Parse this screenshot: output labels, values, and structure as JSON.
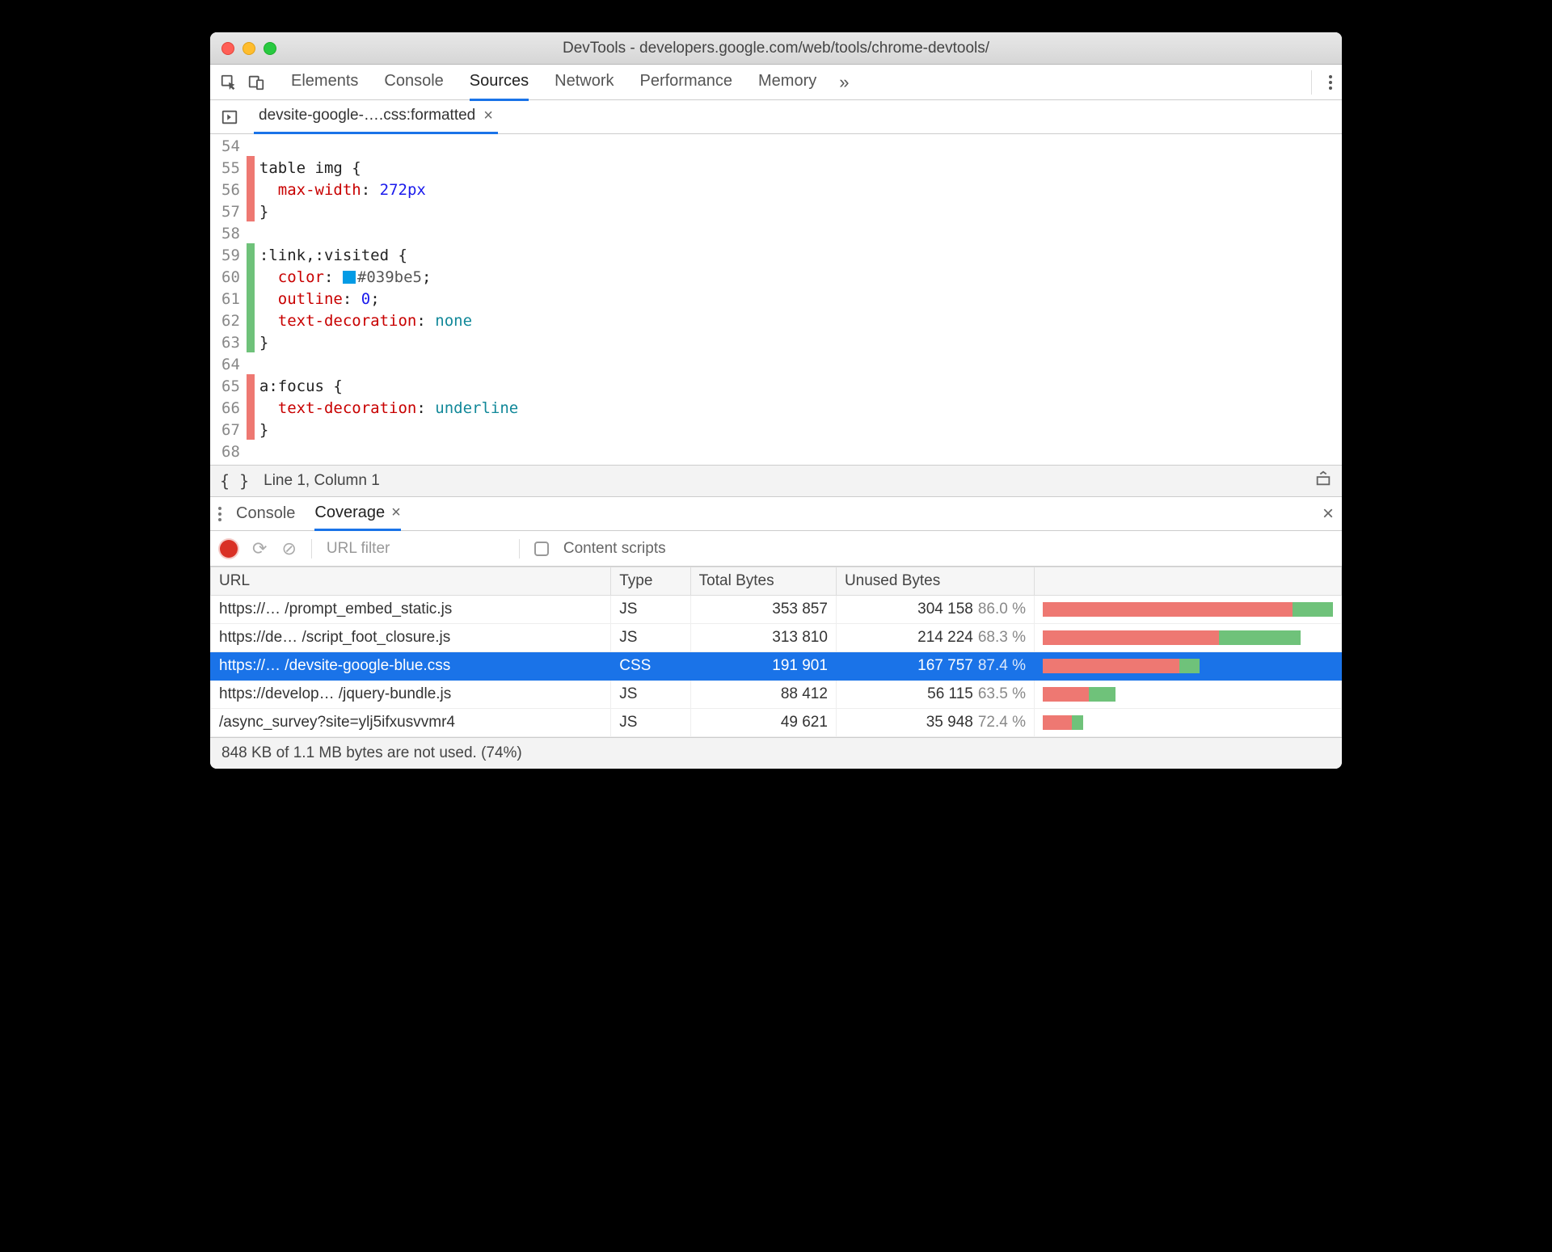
{
  "window": {
    "title": "DevTools - developers.google.com/web/tools/chrome-devtools/"
  },
  "mainTabs": [
    "Elements",
    "Console",
    "Sources",
    "Network",
    "Performance",
    "Memory"
  ],
  "mainTabActive": "Sources",
  "fileTab": {
    "name": "devsite-google-….css:formatted"
  },
  "code": {
    "startLine": 54,
    "lines": [
      {
        "n": 54,
        "cov": "",
        "html": ""
      },
      {
        "n": 55,
        "cov": "red",
        "html": "<span class='tok-sel'>table img</span> <span class='tok-brace'>{</span>"
      },
      {
        "n": 56,
        "cov": "red",
        "html": "  <span class='tok-prop'>max-width</span>: <span class='tok-val'>272px</span>"
      },
      {
        "n": 57,
        "cov": "red",
        "html": "<span class='tok-brace'>}</span>"
      },
      {
        "n": 58,
        "cov": "",
        "html": ""
      },
      {
        "n": 59,
        "cov": "green",
        "html": "<span class='tok-sel'>:link,:visited</span> <span class='tok-brace'>{</span>"
      },
      {
        "n": 60,
        "cov": "green",
        "html": "  <span class='tok-prop'>color</span>: <span class='swatch' style='background:#039be5'></span><span class='tok-color'>#039be5</span>;"
      },
      {
        "n": 61,
        "cov": "green",
        "html": "  <span class='tok-prop'>outline</span>: <span class='tok-val'>0</span>;"
      },
      {
        "n": 62,
        "cov": "green",
        "html": "  <span class='tok-prop'>text-decoration</span>: <span class='tok-kw'>none</span>"
      },
      {
        "n": 63,
        "cov": "green",
        "html": "<span class='tok-brace'>}</span>"
      },
      {
        "n": 64,
        "cov": "",
        "html": ""
      },
      {
        "n": 65,
        "cov": "red",
        "html": "<span class='tok-sel'>a:focus</span> <span class='tok-brace'>{</span>"
      },
      {
        "n": 66,
        "cov": "red",
        "html": "  <span class='tok-prop'>text-decoration</span>: <span class='tok-kw'>underline</span>"
      },
      {
        "n": 67,
        "cov": "red",
        "html": "<span class='tok-brace'>}</span>"
      },
      {
        "n": 68,
        "cov": "",
        "html": ""
      }
    ]
  },
  "status": {
    "cursor": "Line 1, Column 1"
  },
  "drawerTabs": [
    "Console",
    "Coverage"
  ],
  "drawerActive": "Coverage",
  "coverageToolbar": {
    "urlFilterPlaceholder": "URL filter",
    "contentScriptsLabel": "Content scripts"
  },
  "coverageHeaders": [
    "URL",
    "Type",
    "Total Bytes",
    "Unused Bytes",
    ""
  ],
  "coverageRows": [
    {
      "url": "https://… /prompt_embed_static.js",
      "type": "JS",
      "total": "353 857",
      "unused": "304 158",
      "pct": "86.0 %",
      "barUnused": 86.0,
      "barScale": 100,
      "selected": false
    },
    {
      "url": "https://de… /script_foot_closure.js",
      "type": "JS",
      "total": "313 810",
      "unused": "214 224",
      "pct": "68.3 %",
      "barUnused": 68.3,
      "barScale": 89,
      "selected": false
    },
    {
      "url": "https://… /devsite-google-blue.css",
      "type": "CSS",
      "total": "191 901",
      "unused": "167 757",
      "pct": "87.4 %",
      "barUnused": 87.4,
      "barScale": 54,
      "selected": true
    },
    {
      "url": "https://develop… /jquery-bundle.js",
      "type": "JS",
      "total": "88 412",
      "unused": "56 115",
      "pct": "63.5 %",
      "barUnused": 63.5,
      "barScale": 25,
      "selected": false
    },
    {
      "url": "/async_survey?site=ylj5ifxusvvmr4",
      "type": "JS",
      "total": "49 621",
      "unused": "35 948",
      "pct": "72.4 %",
      "barUnused": 72.4,
      "barScale": 14,
      "selected": false
    }
  ],
  "coverageFooter": "848 KB of 1.1 MB bytes are not used. (74%)"
}
